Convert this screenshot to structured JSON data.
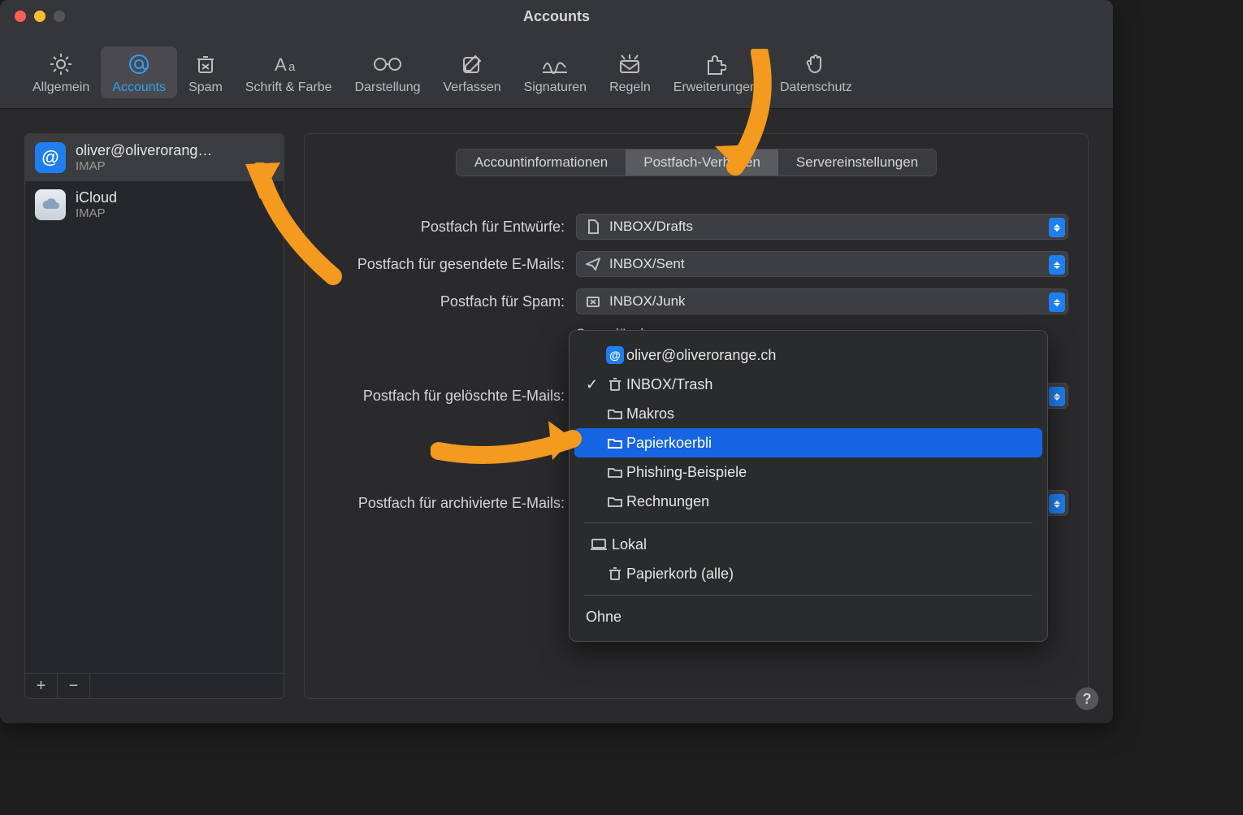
{
  "window": {
    "title": "Accounts"
  },
  "toolbar": {
    "items": [
      {
        "label": "Allgemein"
      },
      {
        "label": "Accounts"
      },
      {
        "label": "Spam"
      },
      {
        "label": "Schrift & Farbe"
      },
      {
        "label": "Darstellung"
      },
      {
        "label": "Verfassen"
      },
      {
        "label": "Signaturen"
      },
      {
        "label": "Regeln"
      },
      {
        "label": "Erweiterungen"
      },
      {
        "label": "Datenschutz"
      }
    ],
    "selected_index": 1
  },
  "accounts": {
    "items": [
      {
        "name": "oliver@oliverorang…",
        "sub": "IMAP",
        "badge": "@",
        "badge_kind": "blue"
      },
      {
        "name": "iCloud",
        "sub": "IMAP",
        "badge": "",
        "badge_kind": "cloud"
      }
    ],
    "selected_index": 0
  },
  "tabs": {
    "items": [
      {
        "label": "Accountinformationen"
      },
      {
        "label": "Postfach-Verhalten"
      },
      {
        "label": "Servereinstellungen"
      }
    ],
    "active_index": 1
  },
  "rows": {
    "drafts": {
      "label": "Postfach für Entwürfe:",
      "value": "INBOX/Drafts"
    },
    "sent": {
      "label": "Postfach für gesendete E-Mails:",
      "value": "INBOX/Sent"
    },
    "junk": {
      "label": "Postfach für Spam:",
      "value": "INBOX/Junk"
    },
    "junk_del": {
      "label": "Spam löschen:"
    },
    "trash": {
      "label": "Postfach für gelöschte E-Mails:"
    },
    "archive": {
      "label": "Postfach für archivierte E-Mails:"
    }
  },
  "popup": {
    "header": "oliver@oliverorange.ch",
    "items": [
      {
        "label": "INBOX/Trash",
        "icon": "trash",
        "checked": true
      },
      {
        "label": "Makros",
        "icon": "folder"
      },
      {
        "label": "Papierkoerbli",
        "icon": "folder",
        "selected": true
      },
      {
        "label": "Phishing-Beispiele",
        "icon": "folder"
      },
      {
        "label": "Rechnungen",
        "icon": "folder"
      }
    ],
    "local_label": "Lokal",
    "local_item": {
      "label": "Papierkorb (alle)",
      "icon": "trash"
    },
    "none_label": "Ohne"
  },
  "help_label": "?"
}
